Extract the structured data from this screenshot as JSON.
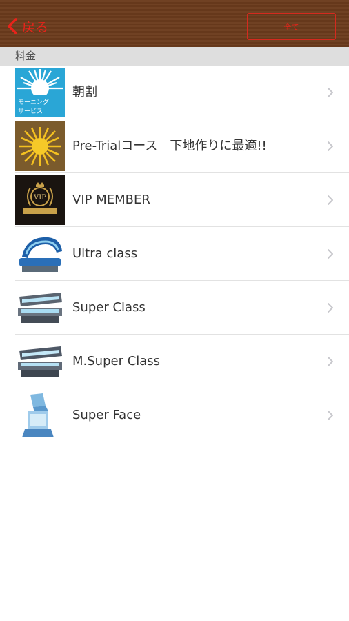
{
  "nav": {
    "back_label": "戻る",
    "all_button_label": "全て",
    "bar_color": "#6b3b1c",
    "accent_color": "#e8231a"
  },
  "section": {
    "title": "料金"
  },
  "items": [
    {
      "label": "朝割",
      "thumb_text_1": "モーニング",
      "thumb_text_2": "サービス",
      "thumb_icon": "sunburst-blue-icon"
    },
    {
      "label": "Pre-Trialコース　下地作りに最適!!",
      "thumb_icon": "sunburst-gold-icon"
    },
    {
      "label": "VIP MEMBER",
      "thumb_text_1": "VIP",
      "thumb_icon": "vip-badge-icon"
    },
    {
      "label": "Ultra class",
      "thumb_icon": "tanning-bed-icon"
    },
    {
      "label": "Super Class",
      "thumb_icon": "tanning-bed-icon"
    },
    {
      "label": "M.Super Class",
      "thumb_icon": "tanning-bed-icon"
    },
    {
      "label": "Super Face",
      "thumb_icon": "face-tanner-icon"
    }
  ]
}
